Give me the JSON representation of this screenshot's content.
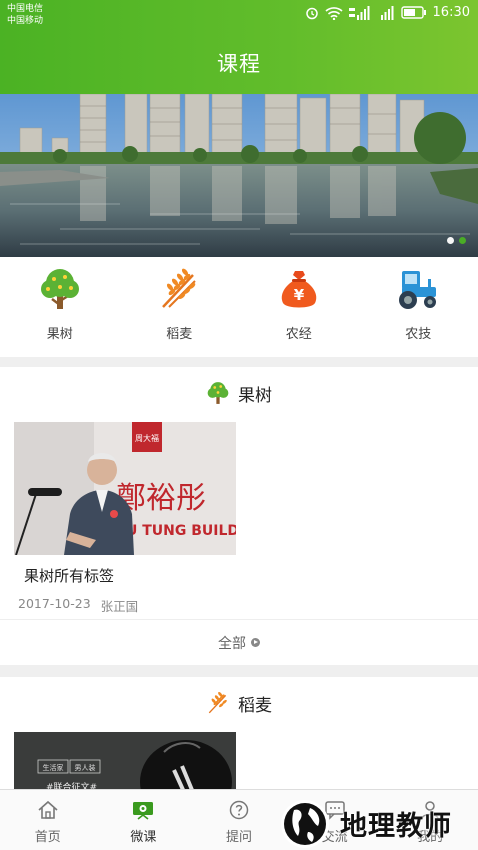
{
  "status_bar": {
    "carrier_1": "中国电信",
    "carrier_2": "中国移动",
    "time": "16:30"
  },
  "header": {
    "title": "课程"
  },
  "banner": {
    "slides": 2,
    "active_slide": 2
  },
  "categories": [
    {
      "label": "果树",
      "icon": "fruit-tree-icon"
    },
    {
      "label": "稻麦",
      "icon": "wheat-icon"
    },
    {
      "label": "农经",
      "icon": "money-bag-icon"
    },
    {
      "label": "农技",
      "icon": "tractor-icon"
    }
  ],
  "sections": [
    {
      "title": "果树",
      "icon": "fruit-tree-icon",
      "course": {
        "title": "果树所有标签",
        "date": "2017-10-23",
        "author": "张正国",
        "image_sign_text": "鄭裕彤",
        "image_sign_sub": "U TUNG BUILDIN",
        "image_plaque": "周大福"
      },
      "more_label": "全部"
    },
    {
      "title": "稻麦",
      "icon": "wheat-icon",
      "course": {
        "image_tag_1": "生活家",
        "image_tag_2": "男人装",
        "image_caption": "#联合征文#"
      }
    }
  ],
  "tabbar": [
    {
      "label": "首页",
      "icon": "home-icon"
    },
    {
      "label": "微课",
      "icon": "video-lesson-icon",
      "active": true
    },
    {
      "label": "提问",
      "icon": "question-icon"
    },
    {
      "label": "交流",
      "icon": "chat-icon"
    },
    {
      "label": "我的",
      "icon": "user-icon"
    }
  ],
  "watermark": {
    "text": "地理教师"
  },
  "colors": {
    "brand_green": "#4bb224",
    "accent_orange": "#f08a24"
  }
}
